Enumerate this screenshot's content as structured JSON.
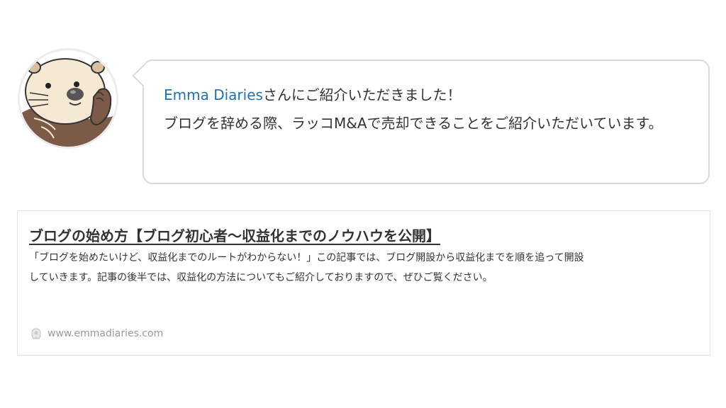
{
  "speech": {
    "link_text": "Emma Diaries",
    "line1_rest": "さんにご紹介いただきました！",
    "line2": "ブログを辞める際、ラッコM&Aで売却できることをご紹介いただいています。"
  },
  "card": {
    "title": "ブログの始め方【ブログ初心者〜収益化までのノウハウを公開】",
    "excerpt": "「ブログを始めたいけど、収益化までのルートがわからない！」この記事では、ブログ開設から収益化までを順を追って開設していきます。記事の後半では、収益化の方法についてもご紹介しておりますので、ぜひご覧ください。",
    "site": "www.emmadiaries.com",
    "site_icon": "site-favicon-icon"
  },
  "avatar": {
    "icon": "sea-otter-icon"
  },
  "colors": {
    "link": "#1a73b8",
    "border": "#d9d9d9",
    "text": "#333333",
    "muted": "#9a9a9a"
  }
}
